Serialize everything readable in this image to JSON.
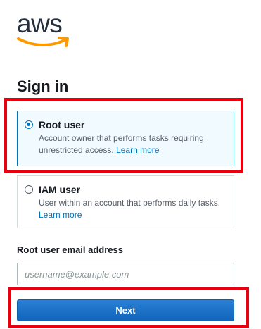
{
  "brand": {
    "logo_text": "aws",
    "logo_icon": "amazon-smile-arrow",
    "logo_text_color": "#232f3e",
    "logo_arrow_color": "#ff9900"
  },
  "page": {
    "title": "Sign in"
  },
  "options": [
    {
      "id": "root",
      "label": "Root user",
      "description": "Account owner that performs tasks requiring unrestricted access.",
      "link": "Learn more",
      "selected": true
    },
    {
      "id": "iam",
      "label": "IAM user",
      "description": "User within an account that performs daily tasks.",
      "link": "Learn more",
      "selected": false
    }
  ],
  "email_field": {
    "label": "Root user email address",
    "value": "",
    "placeholder": "username@example.com"
  },
  "next_button": {
    "label": "Next"
  },
  "colors": {
    "accent": "#0073bb",
    "button": "#1166bb",
    "annotation_highlight": "#e8000f"
  }
}
